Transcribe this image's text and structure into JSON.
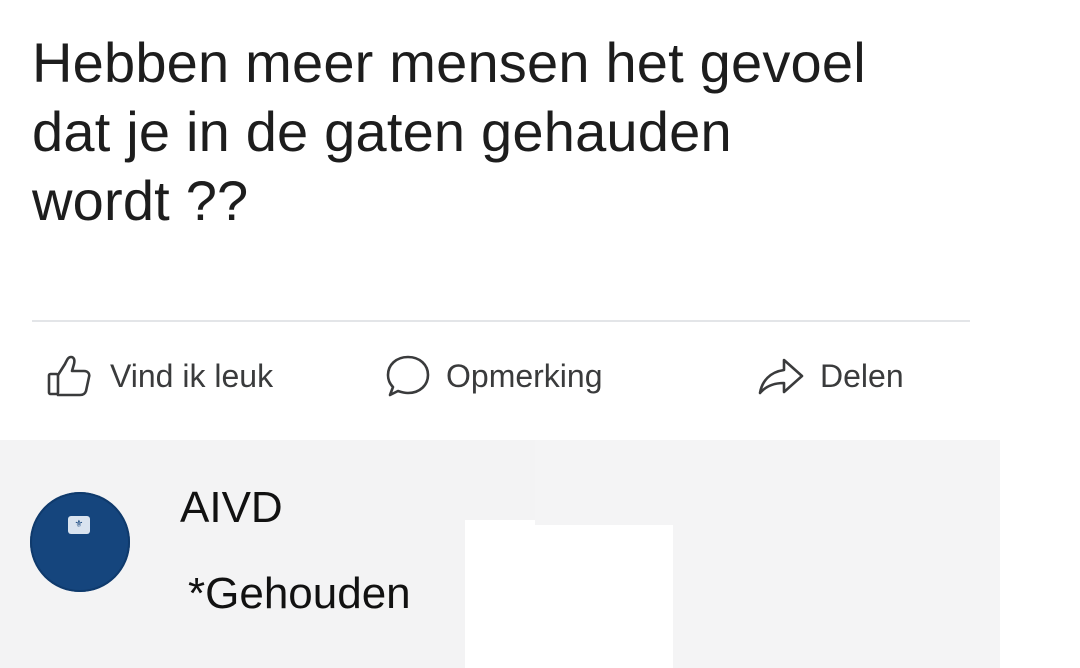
{
  "post": {
    "text_lines": [
      "Hebben meer mensen het gevoel",
      "dat je in de gaten gehauden",
      "wordt ??"
    ]
  },
  "actions": {
    "like": {
      "label": "Vind ik leuk",
      "icon": "thumbs-up-icon"
    },
    "comment": {
      "label": "Opmerking",
      "icon": "comment-bubble-icon"
    },
    "share": {
      "label": "Delen",
      "icon": "share-arrow-icon"
    }
  },
  "comment": {
    "author": "AIVD",
    "text": "*Gehouden",
    "avatar": {
      "icon": "crest-emblem-icon",
      "color": "#15457d"
    }
  },
  "colors": {
    "text": "#1d1d1d",
    "action_text": "#3a3b3c",
    "comment_background": "#f3f3f4",
    "avatar": "#15457d"
  }
}
